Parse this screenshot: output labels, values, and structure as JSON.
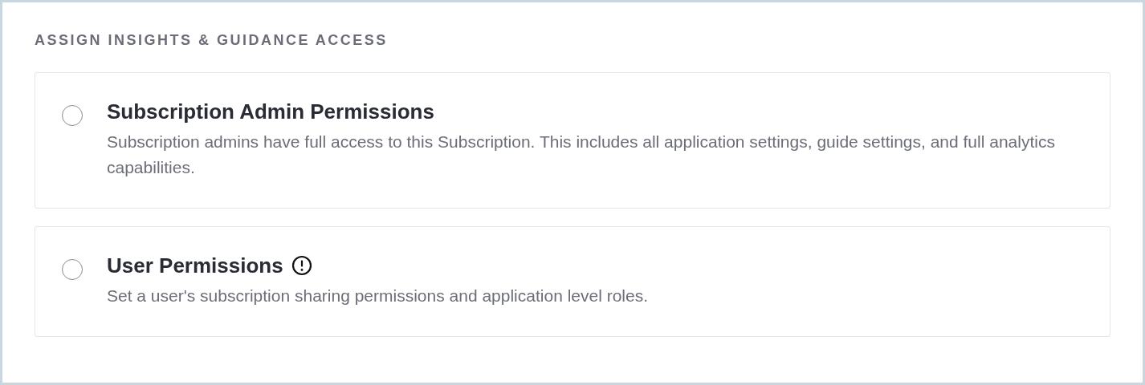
{
  "section": {
    "title": "ASSIGN INSIGHTS & GUIDANCE ACCESS"
  },
  "options": [
    {
      "title": "Subscription Admin Permissions",
      "description": "Subscription admins have full access to this Subscription. This includes all application settings, guide settings, and full analytics capabilities.",
      "selected": false,
      "info_icon": false
    },
    {
      "title": "User Permissions",
      "description": "Set a user's subscription sharing permissions and application level roles.",
      "selected": false,
      "info_icon": true
    }
  ]
}
